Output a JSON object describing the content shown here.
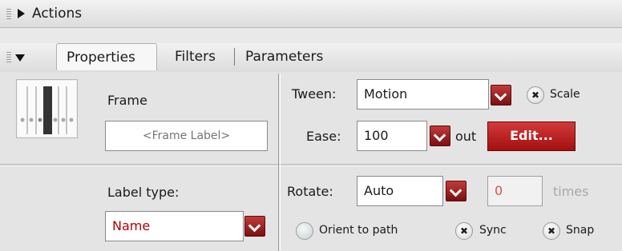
{
  "panels": {
    "actions_title": "Actions",
    "tabs": [
      "Properties",
      "Filters",
      "Parameters"
    ]
  },
  "frame": {
    "label": "Frame",
    "label_placeholder": "<Frame Label>",
    "label_type_label": "Label type:",
    "label_type_value": "Name"
  },
  "tween": {
    "tween_label": "Tween:",
    "tween_value": "Motion",
    "scale_label": "Scale",
    "scale_checked": true,
    "ease_label": "Ease:",
    "ease_value": "100",
    "ease_suffix": "out",
    "edit_label": "Edit...",
    "rotate_label": "Rotate:",
    "rotate_value": "Auto",
    "times_value": "0",
    "times_label": "times",
    "orient_label": "Orient to path",
    "orient_checked": false,
    "sync_label": "Sync",
    "sync_checked": true,
    "snap_label": "Snap",
    "snap_checked": true
  },
  "colors": {
    "accent_red": "#a40f0f",
    "name_text": "#b30000"
  },
  "icons": {
    "dropdown": "chevron-down-icon",
    "checked": "x-mark-icon"
  }
}
